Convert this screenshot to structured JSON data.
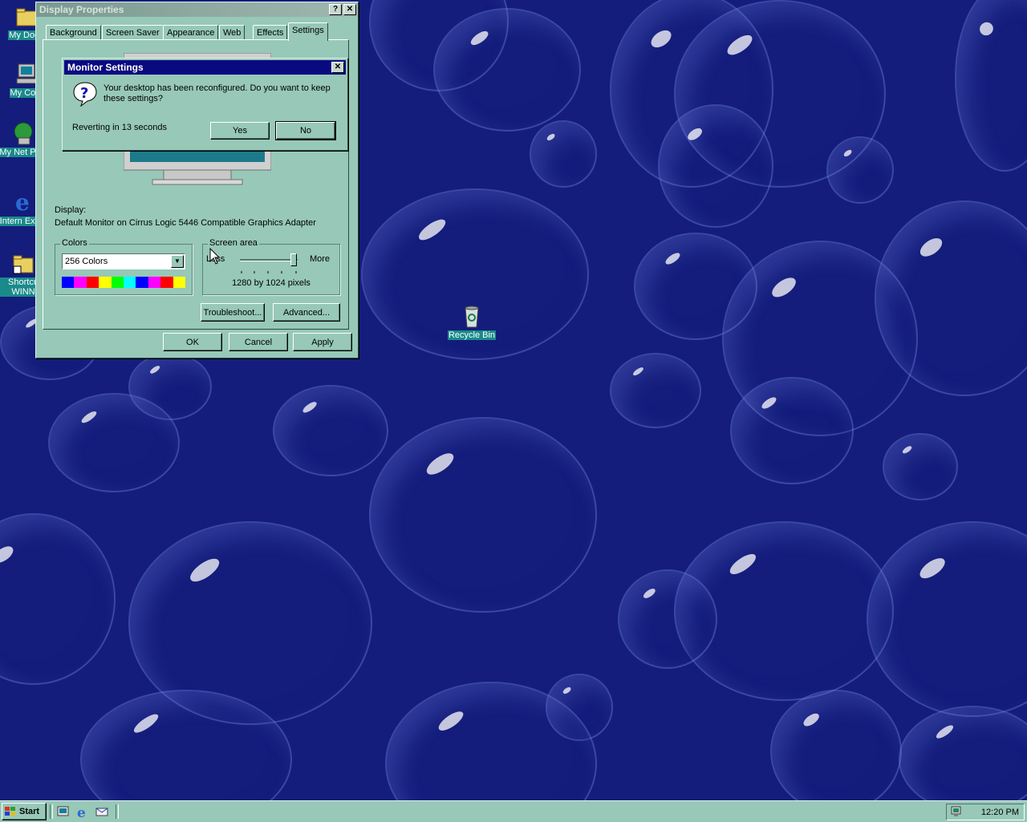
{
  "desktop": {
    "icons": [
      {
        "label": "My Docu"
      },
      {
        "label": "My Com"
      },
      {
        "label": "My Net Plac"
      },
      {
        "label": "Intern Explo"
      },
      {
        "label": "Shortcu WINN"
      },
      {
        "label": "Recycle Bin"
      }
    ],
    "background_color": "#141d7c"
  },
  "display_properties": {
    "title": "Display Properties",
    "help_btn": "?",
    "close_btn": "✕",
    "tabs": [
      "Background",
      "Screen Saver",
      "Appearance",
      "Web",
      "Effects",
      "Settings"
    ],
    "selected_tab": "Settings",
    "display_label": "Display:",
    "display_value": "Default Monitor on Cirrus Logic 5446 Compatible Graphics Adapter",
    "colors": {
      "legend": "Colors",
      "selected": "256 Colors",
      "palette": [
        "#0000ff",
        "#ff00ff",
        "#ff0000",
        "#ffff00",
        "#00ff00",
        "#00ffff",
        "#0000ff",
        "#ff00ff",
        "#ff0000",
        "#ffff00"
      ]
    },
    "screen_area": {
      "legend": "Screen area",
      "less": "Less",
      "more": "More",
      "value": "1280 by 1024 pixels",
      "slider_level": 0.95
    },
    "buttons": {
      "troubleshoot": "Troubleshoot...",
      "advanced": "Advanced...",
      "ok": "OK",
      "cancel": "Cancel",
      "apply": "Apply"
    }
  },
  "monitor_dialog": {
    "title": "Monitor Settings",
    "close_btn": "✕",
    "message": "Your desktop has been reconfigured.  Do you want to keep these settings?",
    "countdown": "Reverting in 13 seconds",
    "yes": "Yes",
    "no": "No"
  },
  "taskbar": {
    "start": "Start",
    "clock": "12:20 PM"
  }
}
